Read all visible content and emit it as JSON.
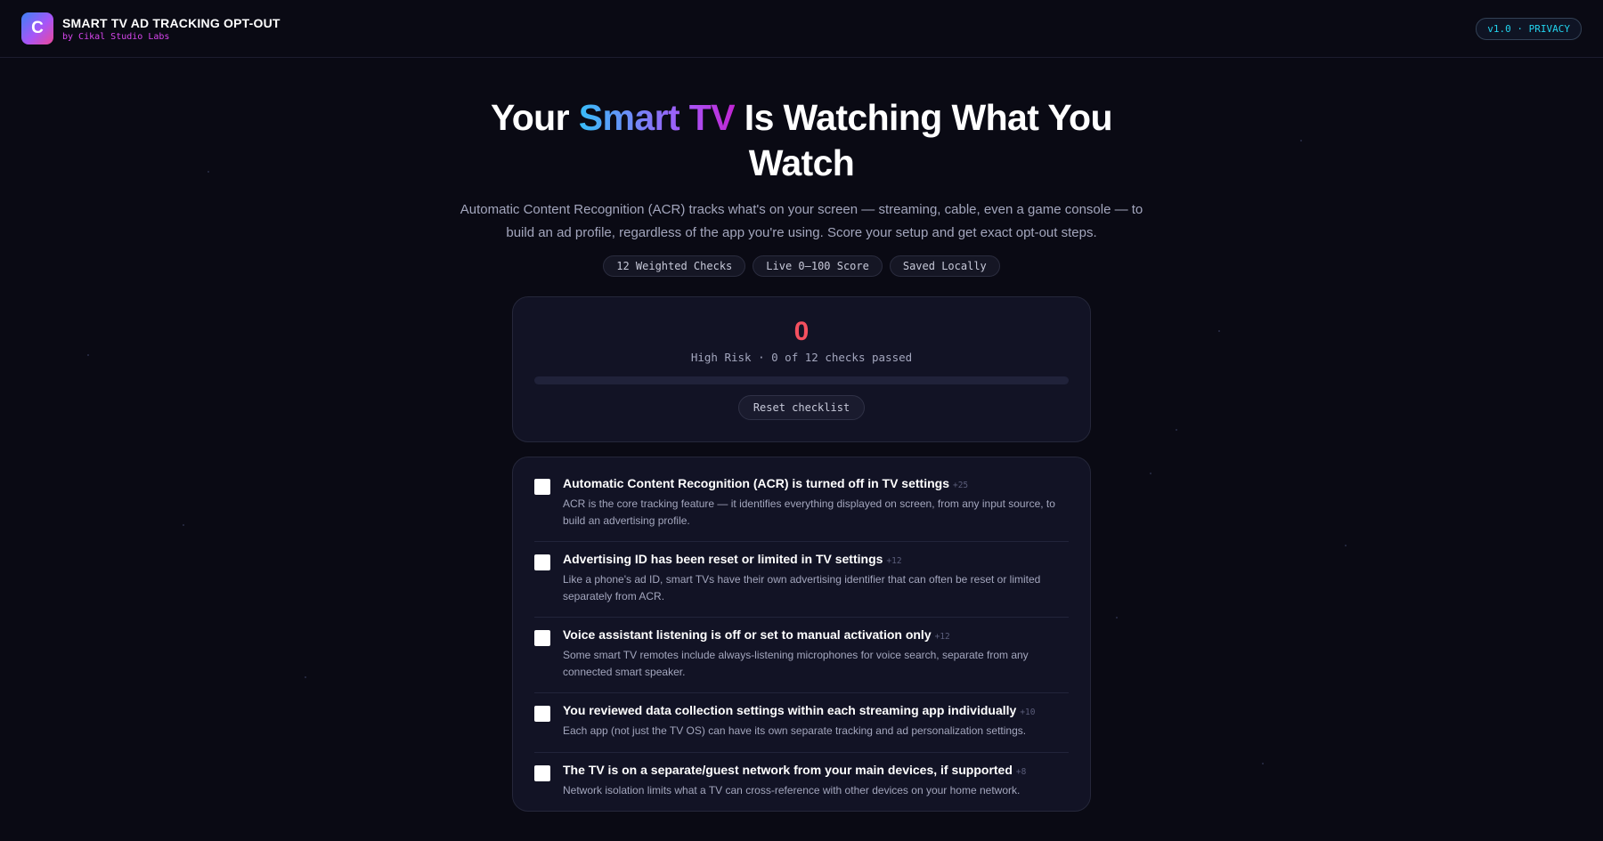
{
  "header": {
    "logo_letter": "C",
    "title": "SMART TV AD TRACKING OPT-OUT",
    "subtitle": "by Cikal Studio Labs",
    "version_badge": "v1.0 · PRIVACY"
  },
  "hero": {
    "title_part1": "Your ",
    "title_highlight": "Smart TV",
    "title_part2": " Is Watching What You Watch",
    "description": "Automatic Content Recognition (ACR) tracks what's on your screen — streaming, cable, even a game console — to build an ad profile, regardless of the app you're using. Score your setup and get exact opt-out steps.",
    "pills": [
      "12 Weighted Checks",
      "Live 0–100 Score",
      "Saved Locally"
    ]
  },
  "score_card": {
    "score": "0",
    "status": "High Risk · 0 of 12 checks passed",
    "progress_fraction": 0,
    "reset_label": "Reset checklist"
  },
  "checklist": {
    "items": [
      {
        "title": "Automatic Content Recognition (ACR) is turned off in TV settings",
        "weight": "+25",
        "description": "ACR is the core tracking feature — it identifies everything displayed on screen, from any input source, to build an advertising profile.",
        "checked": false
      },
      {
        "title": "Advertising ID has been reset or limited in TV settings",
        "weight": "+12",
        "description": "Like a phone's ad ID, smart TVs have their own advertising identifier that can often be reset or limited separately from ACR.",
        "checked": false
      },
      {
        "title": "Voice assistant listening is off or set to manual activation only",
        "weight": "+12",
        "description": "Some smart TV remotes include always-listening microphones for voice search, separate from any connected smart speaker.",
        "checked": false
      },
      {
        "title": "You reviewed data collection settings within each streaming app individually",
        "weight": "+10",
        "description": "Each app (not just the TV OS) can have its own separate tracking and ad personalization settings.",
        "checked": false
      },
      {
        "title": "The TV is on a separate/guest network from your main devices, if supported",
        "weight": "+8",
        "description": "Network isolation limits what a TV can cross-reference with other devices on your home network.",
        "checked": false
      }
    ]
  },
  "colors": {
    "background": "#0a0a14",
    "risk_red": "#f4505f",
    "accent_cyan": "#22d3ee",
    "accent_magenta": "#d946ef"
  }
}
